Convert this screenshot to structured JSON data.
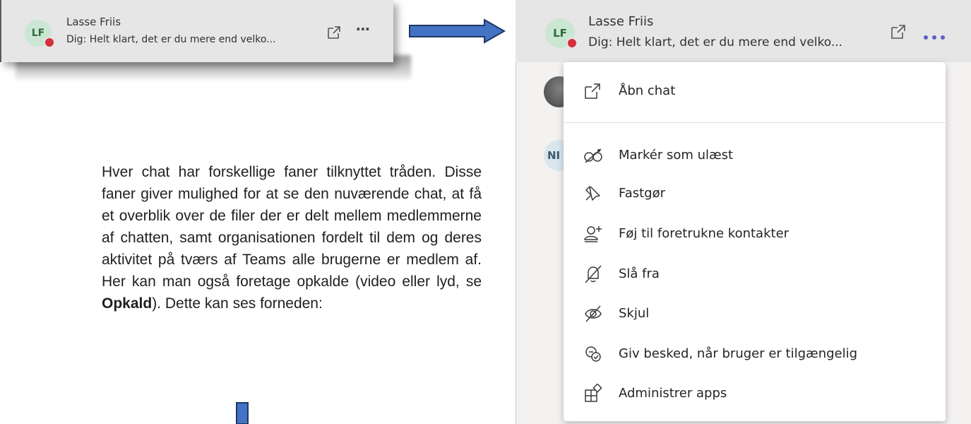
{
  "chat_preview": {
    "avatar_initials": "LF",
    "name": "Lasse Friis",
    "last_message": "Dig: Helt klart, det er du mere end velko...",
    "open_icon": "popout-icon",
    "more_icon": "more-horizontal-icon"
  },
  "paragraph": {
    "text_1": "Hver chat har forskellige faner tilknyttet tråden. Disse faner giver mulighed for at se den nuværende chat, at få et overblik over de filer der er delt mellem medlemmerne af chatten, samt organisationen fordelt til dem og deres aktivitet på tværs af Teams alle brugerne er medlem af. Her kan man også foretage opkalde (video eller lyd, se ",
    "bold": "Opkald",
    "text_2": "). Dette kan ses forneden:"
  },
  "right_screenshot": {
    "avatar_initials": "LF",
    "name": "Lasse Friis",
    "last_message": "Dig: Helt klart, det er du mere end velko...",
    "partial_avatar_initials": "NI",
    "menu_items": [
      {
        "label": "Åbn chat",
        "icon": "popout-icon"
      },
      {
        "label": "Markér som ulæst",
        "icon": "mark-unread-icon"
      },
      {
        "label": "Fastgør",
        "icon": "pin-icon"
      },
      {
        "label": "Føj til foretrukne kontakter",
        "icon": "add-contact-icon"
      },
      {
        "label": "Slå fra",
        "icon": "mute-bell-icon"
      },
      {
        "label": "Skjul",
        "icon": "hide-icon"
      },
      {
        "label": "Giv besked, når bruger er tilgængelig",
        "icon": "notify-available-icon"
      },
      {
        "label": "Administrer apps",
        "icon": "manage-apps-icon"
      }
    ]
  },
  "colors": {
    "accent": "#5b5fc7",
    "status_busy": "#d62f3c",
    "arrow_fill": "#4472c4",
    "arrow_stroke": "#1f3864"
  }
}
